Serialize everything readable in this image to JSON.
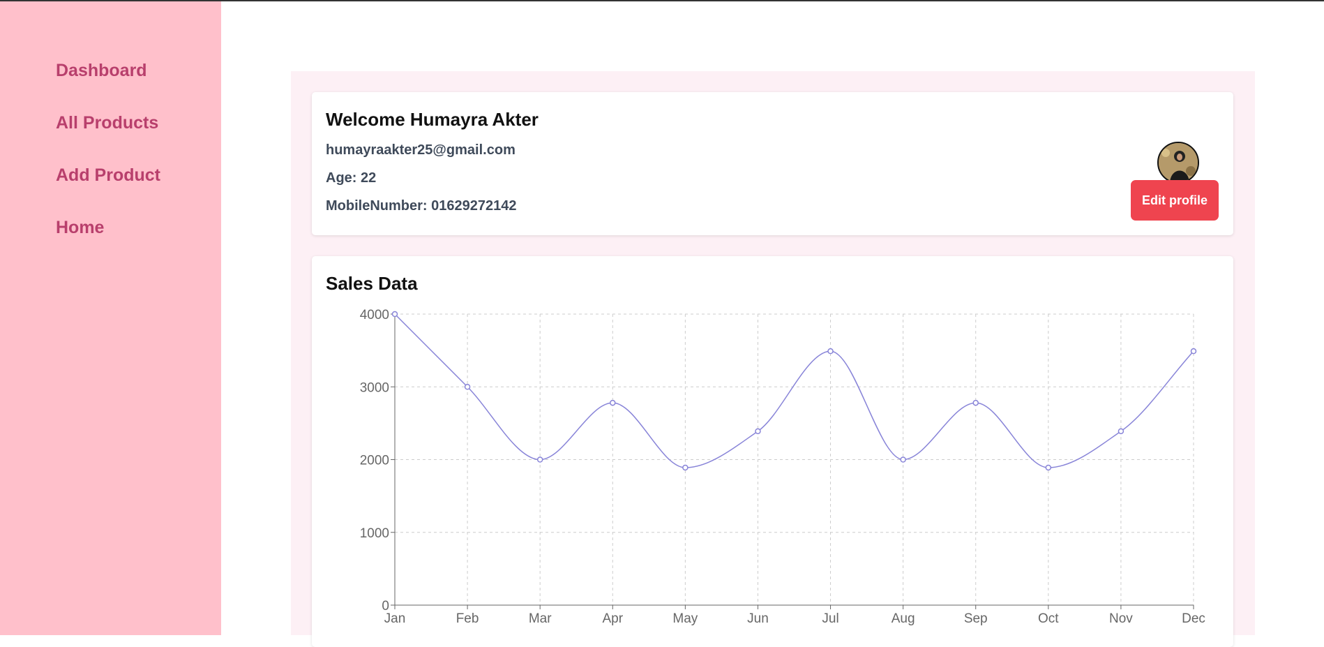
{
  "sidebar": {
    "items": [
      {
        "label": "Dashboard"
      },
      {
        "label": "All Products"
      },
      {
        "label": "Add Product"
      },
      {
        "label": "Home"
      }
    ]
  },
  "profile": {
    "welcome": "Welcome Humayra Akter",
    "email": "humayraakter25@gmail.com",
    "age": "Age: 22",
    "mobile": "MobileNumber: 01629272142",
    "edit_label": "Edit profile",
    "avatar_icon": "user-photo-avatar"
  },
  "colors": {
    "sidebar_bg": "#ffc0cb",
    "nav_text": "#b83f6c",
    "content_bg": "#fdf0f5",
    "edit_button": "#ef444f",
    "series_line": "#8884d8"
  },
  "chart": {
    "title": "Sales Data"
  },
  "chart_data": {
    "type": "line",
    "title": "Sales Data",
    "categories": [
      "Jan",
      "Feb",
      "Mar",
      "Apr",
      "May",
      "Jun",
      "Jul",
      "Aug",
      "Sep",
      "Oct",
      "Nov",
      "Dec"
    ],
    "series": [
      {
        "values": [
          4000,
          3000,
          2000,
          2780,
          1890,
          2390,
          3490,
          2000,
          2780,
          1890,
          2390,
          3490
        ]
      }
    ],
    "yticks": [
      "0",
      "1000",
      "2000",
      "3000",
      "4000"
    ],
    "ylim": [
      0,
      4000
    ],
    "xlabel": "",
    "ylabel": "",
    "grid": true,
    "smooth": true
  }
}
